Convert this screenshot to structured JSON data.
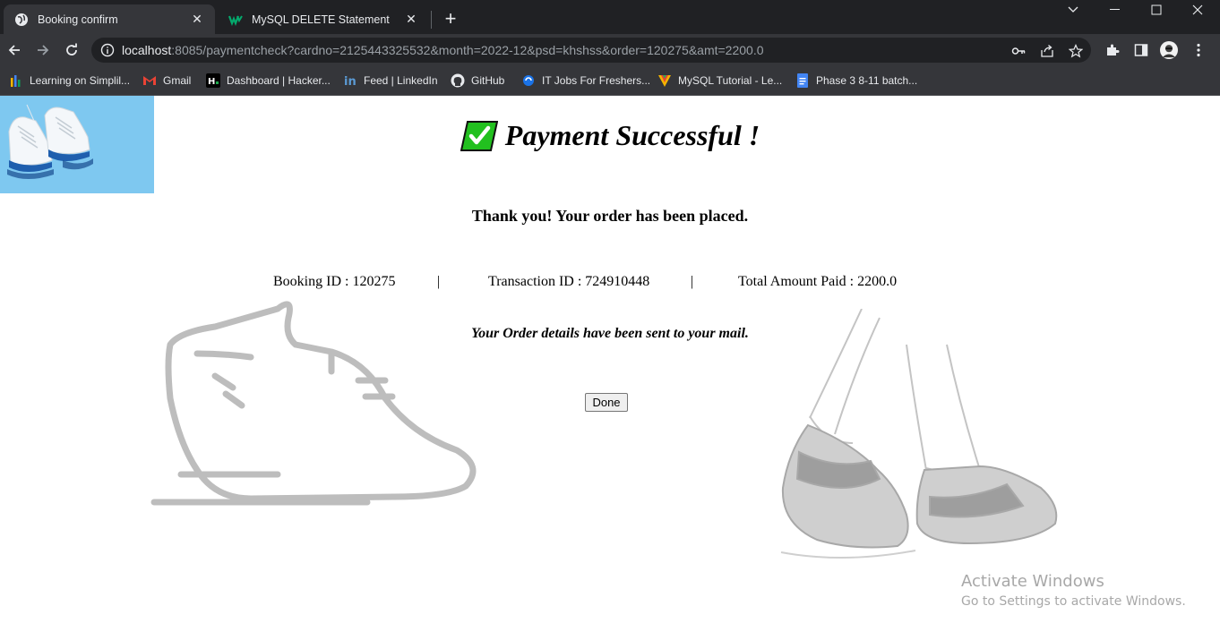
{
  "browser": {
    "tabs": [
      {
        "title": "Booking confirm",
        "active": true
      },
      {
        "title": "MySQL DELETE Statement",
        "active": false
      }
    ],
    "url": {
      "host": "localhost",
      "rest": ":8085/paymentcheck?cardno=2125443325532&month=2022-12&psd=khshss&order=120275&amt=2200.0"
    },
    "bookmarks": [
      "Learning on Simplil...",
      "Gmail",
      "Dashboard | Hacker...",
      "Feed | LinkedIn",
      "GitHub",
      "IT Jobs For Freshers...",
      "MySQL Tutorial - Le...",
      "Phase 3 8-11 batch..."
    ]
  },
  "page": {
    "headline": "Payment Successful !",
    "thanks": "Thank you! Your order has been placed.",
    "booking": {
      "label": "Booking ID : 120275"
    },
    "transaction": {
      "label": "Transaction ID : 724910448"
    },
    "amount": {
      "label": "Total Amount Paid : 2200.0"
    },
    "separator": "|",
    "mail_note": "Your Order details have been sent to your mail.",
    "done_label": "Done"
  },
  "os": {
    "activate_title": "Activate Windows",
    "activate_sub": "Go to Settings to activate Windows."
  },
  "colors": {
    "chrome_dark": "#202124",
    "chrome_toolbar": "#35363a",
    "logo_bg": "#7ec8f0",
    "check_green": "#22c01f",
    "shoe_gray": "#bdbdbd"
  }
}
